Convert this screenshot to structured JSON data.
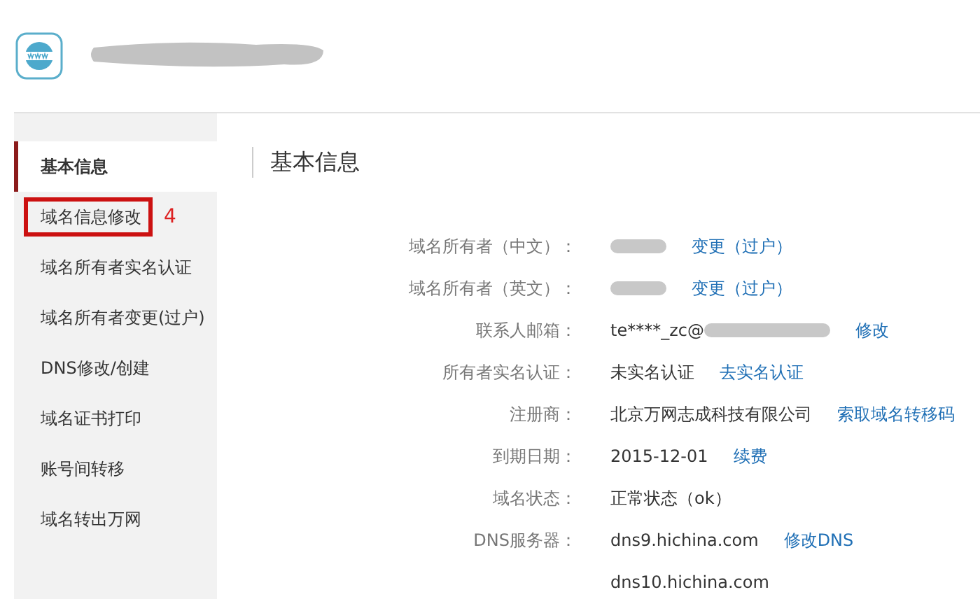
{
  "header": {
    "name_redacted": true
  },
  "sidebar": {
    "items": [
      {
        "label": "基本信息",
        "selected": true,
        "annotated": false
      },
      {
        "label": "域名信息修改",
        "selected": false,
        "annotated": true,
        "annotation": "4"
      },
      {
        "label": "域名所有者实名认证",
        "selected": false,
        "annotated": false
      },
      {
        "label": "域名所有者变更(过户)",
        "selected": false,
        "annotated": false
      },
      {
        "label": "DNS修改/创建",
        "selected": false,
        "annotated": false
      },
      {
        "label": "域名证书打印",
        "selected": false,
        "annotated": false
      },
      {
        "label": "账号间转移",
        "selected": false,
        "annotated": false
      },
      {
        "label": "域名转出万网",
        "selected": false,
        "annotated": false
      }
    ]
  },
  "content": {
    "title": "基本信息",
    "rows": [
      {
        "label": "域名所有者（中文）：",
        "redacted": true,
        "link": "变更（过户）"
      },
      {
        "label": "域名所有者（英文）：",
        "redacted": true,
        "link": "变更（过户）"
      },
      {
        "label": "联系人邮箱：",
        "value": "te****_zc@",
        "redacted": true,
        "link": "修改"
      },
      {
        "label": "所有者实名认证：",
        "value": "未实名认证",
        "redacted": false,
        "link": "去实名认证"
      },
      {
        "label": "注册商：",
        "value": "北京万网志成科技有限公司",
        "redacted": false,
        "link": "索取域名转移码"
      },
      {
        "label": "到期日期：",
        "value": "2015-12-01",
        "redacted": false,
        "link": "续费"
      },
      {
        "label": "域名状态：",
        "value": "正常状态（ok）",
        "redacted": false
      },
      {
        "label": "DNS服务器：",
        "value": "dns9.hichina.com",
        "redacted": false,
        "link": "修改DNS"
      },
      {
        "value": "dns10.hichina.com",
        "redacted": false
      }
    ]
  }
}
